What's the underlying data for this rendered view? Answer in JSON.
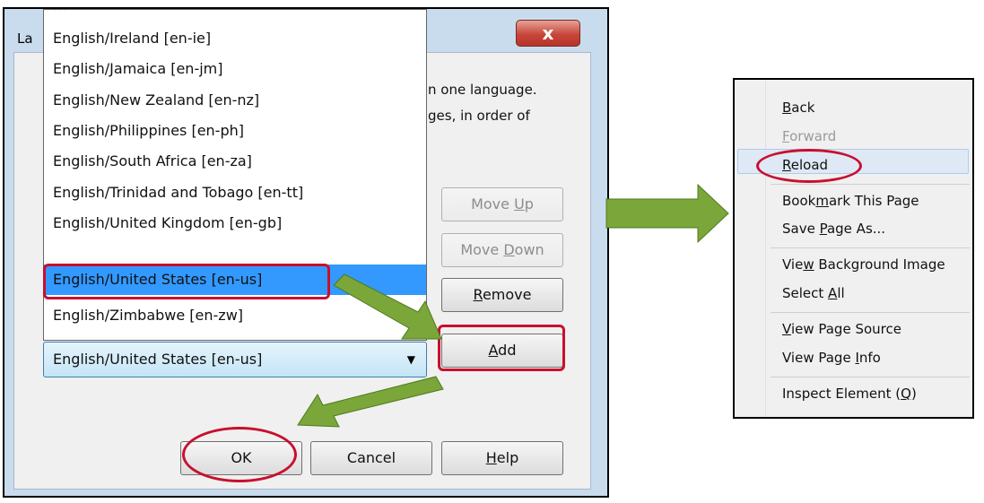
{
  "dialog": {
    "title": "La",
    "close_glyph": "x",
    "text_line1": "n one language.",
    "text_line2": "ges, in order of",
    "list_items": [
      "English/Ireland  [en-ie]",
      "English/Jamaica  [en-jm]",
      "English/New Zealand  [en-nz]",
      "English/Philippines  [en-ph]",
      "English/South Africa  [en-za]",
      "English/Trinidad and Tobago  [en-tt]",
      "English/United Kingdom  [en-gb]",
      "English/United States  [en-us]",
      "English/Zimbabwe  [en-zw]"
    ],
    "selected_index": 7,
    "combo_value": "English/United States  [en-us]",
    "buttons": {
      "move_up": {
        "pre": "Move ",
        "key": "U",
        "post": "p"
      },
      "move_down": {
        "pre": "Move ",
        "key": "D",
        "post": "own"
      },
      "remove": {
        "pre": "",
        "key": "R",
        "post": "emove"
      },
      "add": {
        "pre": "",
        "key": "A",
        "post": "dd"
      },
      "ok": "OK",
      "cancel": "Cancel",
      "help": {
        "pre": "",
        "key": "H",
        "post": "elp"
      }
    }
  },
  "context_menu": {
    "items": [
      {
        "pre": "",
        "key": "B",
        "post": "ack"
      },
      {
        "pre": "",
        "key": "F",
        "post": "orward"
      },
      {
        "pre": "",
        "key": "R",
        "post": "eload"
      },
      {
        "pre": "Book",
        "key": "m",
        "post": "ark This Page"
      },
      {
        "pre": "Save ",
        "key": "P",
        "post": "age As..."
      },
      {
        "pre": "Vie",
        "key": "w",
        "post": " Background Image"
      },
      {
        "pre": "Select ",
        "key": "A",
        "post": "ll"
      },
      {
        "pre": "",
        "key": "V",
        "post": "iew Page Source"
      },
      {
        "pre": "View Page ",
        "key": "I",
        "post": "nfo"
      },
      {
        "pre": "Inspect Element (",
        "key": "Q",
        "post": ")"
      }
    ]
  },
  "colors": {
    "highlight_red": "#c8102e",
    "arrow_green": "#7aa63a",
    "selection_blue": "#3399ff"
  }
}
